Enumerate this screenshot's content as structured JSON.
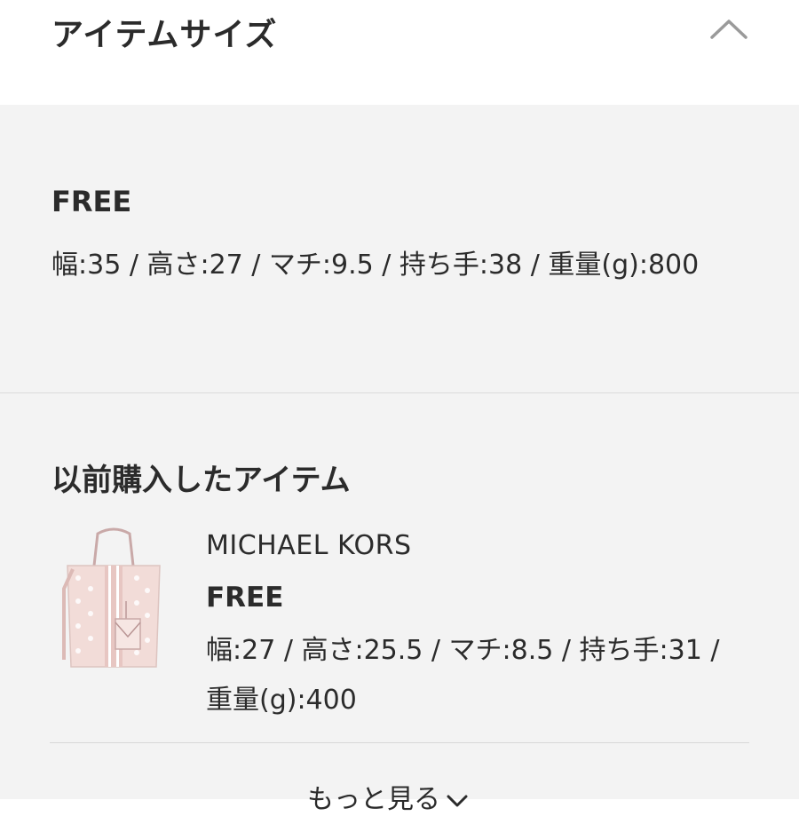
{
  "header": {
    "title": "アイテムサイズ"
  },
  "size_info": {
    "size_name": "FREE",
    "detail": "幅:35 / 高さ:27 / マチ:9.5 / 持ち手:38 / 重量(g):800"
  },
  "purchase_history": {
    "title": "以前購入したアイテム",
    "items": [
      {
        "brand": "MICHAEL KORS",
        "size_name": "FREE",
        "detail": "幅:27 / 高さ:25.5 / マチ:8.5 / 持ち手:31 / 重量(g):400"
      }
    ],
    "more_label": "もっと見る"
  },
  "icons": {
    "collapse": "chevron-up-icon",
    "expand_more": "chevron-down-icon"
  },
  "colors": {
    "panel_bg": "#f3f3f3",
    "text": "#2b2b2b",
    "divider": "#dcdcdc"
  }
}
